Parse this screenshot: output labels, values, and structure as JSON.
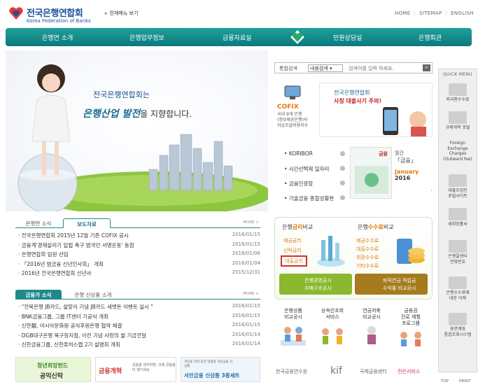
{
  "header": {
    "logo_kr": "전국은행연합회",
    "logo_en": "Korea Federation of Banks",
    "sitemap_link": "전체메뉴 보기",
    "util": [
      "HOME",
      "SITEMAP",
      "ENGLISH"
    ]
  },
  "gnb": [
    "은행연 소개",
    "은행업무정보",
    "금융자료실",
    "민원상담실",
    "은행회관"
  ],
  "hero": {
    "line1": "전국은행연합회는",
    "line2_em": "은행산업 발전",
    "line2_rest": "을 지향합니다."
  },
  "news1": {
    "tabs": [
      "은행연 소식",
      "보도자료"
    ],
    "more": "MORE >",
    "items": [
      {
        "title": "전국은행연합회 2015년 12월 기준 COFIX 공시",
        "date": "2016/01/15"
      },
      {
        "title": "금융계'경제살리기 입법 촉구 범국민 서명운동' 동참",
        "date": "2016/01/15"
      },
      {
        "title": "은행연합회 임원 선임",
        "date": "2016/01/06"
      },
      {
        "title": "「2016년 범금융 신년인사회」 개최",
        "date": "2016/01/04"
      },
      {
        "title": "2016년 전국은행연합회 신년사",
        "date": "2015/12/31"
      }
    ]
  },
  "news2": {
    "tabs": [
      "금융가 소식",
      "은행 신상품 소개"
    ],
    "more": "MORE >",
    "items": [
      {
        "title": "\"전북은행 JB카드, 설맞이 기념 JB카드 세뱃돈 이벤트 실시 \"",
        "date": "2016/01/15"
      },
      {
        "title": "BNK금융그룹, 그룹 IT센터 기공식 개최",
        "date": "2016/01/15"
      },
      {
        "title": "신한銀, 아시아문화원 공식후원은행 협약 체결",
        "date": "2016/01/15"
      },
      {
        "title": "DGB대구은행 북구청지점, 이전 기념 사랑의 쌀 기금전달",
        "date": "2016/01/14"
      },
      {
        "title": "신한금융그룹, 신한퓨처스랩 2기 설명회 개최",
        "date": "2016/01/14"
      }
    ]
  },
  "banners": [
    {
      "line1": "청년희망펀드",
      "line2": "공익신탁"
    },
    {
      "line1": "금융개혁",
      "line2": "금융을 생각하면, 이제 금융을 더 챙기세요"
    },
    {
      "line1": "서민을 위한 중앙 맞춤형 서민금융 신상품",
      "line2": "서민금융 신상품 3종세트"
    }
  ],
  "search": {
    "label": "통합검색",
    "select": "내용검색",
    "placeholder": "검색어를 입력 하세요.",
    "button": ">"
  },
  "cofix": {
    "name": "COFIX",
    "desc": [
      "국내 9개 은행",
      "(정보제공은행)의",
      "자금조달비용지수"
    ]
  },
  "promo": {
    "line1": "전국은행연합회",
    "line2": "사칭 대출사기 주의!"
  },
  "links": [
    "KORIBOR",
    "시간선택제 일자리",
    "금융인광장",
    "기술금융 종합상황판"
  ],
  "magazine": {
    "cover": "금융",
    "label1": "월간",
    "label2": "「금융」",
    "month": "January",
    "year": "2016"
  },
  "rate": {
    "deposit_title_a": "은행",
    "deposit_title_b": "금리",
    "deposit_title_c": "비교",
    "fee_title_a": "은행",
    "fee_title_b": "수수료",
    "fee_title_c": "비교",
    "deposit_items": [
      "예금금리",
      "신탁금리",
      "대출금리"
    ],
    "fee_items": [
      "예금수수료",
      "대출수수료",
      "외환수수료",
      "기타수수료"
    ],
    "btn1": [
      "은행경영공시",
      "지배구조공시"
    ],
    "btn2": [
      "퇴직연금 적립금",
      "수익률 비교공시"
    ]
  },
  "services": [
    {
      "l1": "은행상품",
      "l2": "비교공시"
    },
    {
      "l1": "상속인조회",
      "l2": "서비스"
    },
    {
      "l1": "연금저축",
      "l2": "비교공시"
    },
    {
      "l1": "금융권",
      "l2": "진로 체험",
      "l3": "프로그램"
    }
  ],
  "partners": [
    "한국금융연수원",
    "kif",
    "국제금융센터",
    "전은서비스"
  ],
  "quick": {
    "title": "QUICK MENU",
    "items": [
      [
        "외국환수수료"
      ],
      [
        "규제개혁 포털"
      ],
      [
        "Foreign",
        "Exchange",
        "Charges",
        "(Outward fee)"
      ],
      [
        "대출모집인",
        "포털사이트"
      ],
      [
        "새희망홀씨"
      ],
      [
        "은행콜센터",
        "전화번호"
      ],
      [
        "은행수수료에",
        "대한 이해"
      ],
      [
        "휴면계좌",
        "통합조회시스템"
      ]
    ],
    "top": "TOP",
    "print": "PRINT"
  }
}
